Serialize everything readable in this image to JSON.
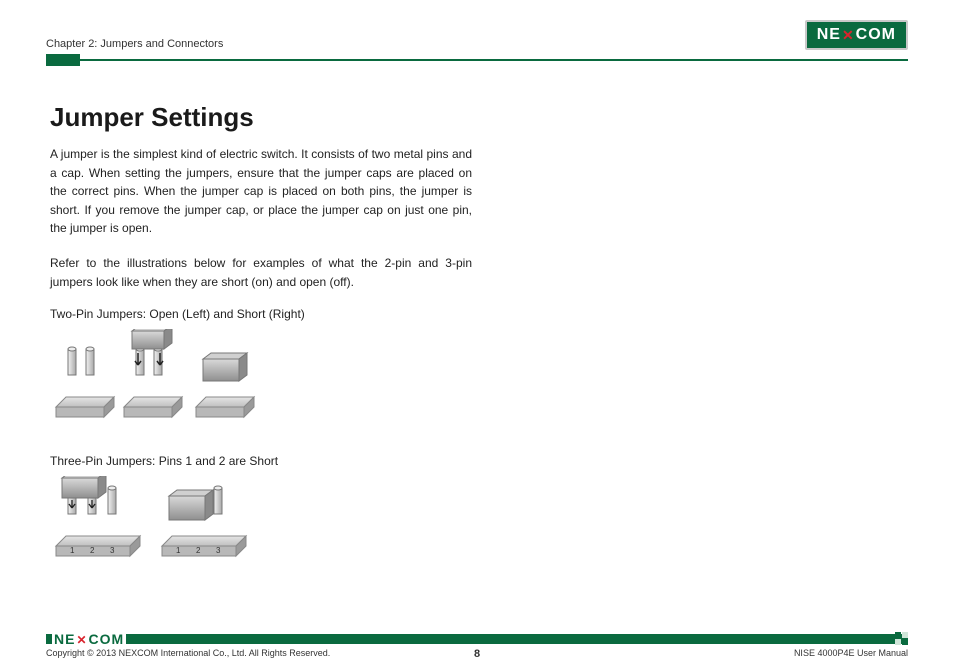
{
  "brand": "NEXCOM",
  "header": {
    "chapter": "Chapter 2: Jumpers and Connectors"
  },
  "title": "Jumper Settings",
  "paragraphs": {
    "p1": "A jumper is the simplest kind of electric switch. It consists of two metal pins and a cap. When setting the jumpers, ensure that the jumper caps are placed on the correct pins. When the jumper cap is placed on both pins, the jumper is short. If you remove the jumper cap, or place the jumper cap on just one pin, the jumper is open.",
    "p2": "Refer to the illustrations below for examples of what the 2-pin and 3-pin jumpers look like when they are short (on) and open (off)."
  },
  "captions": {
    "twoPin": "Two-Pin Jumpers: Open (Left) and Short (Right)",
    "threePin": "Three-Pin Jumpers: Pins 1 and 2 are Short"
  },
  "pinLabels": {
    "p1": "1",
    "p2": "2",
    "p3": "3"
  },
  "footer": {
    "copyright": "Copyright © 2013 NEXCOM International Co., Ltd. All Rights Reserved.",
    "page": "8",
    "manual": "NISE 4000P4E User Manual"
  }
}
